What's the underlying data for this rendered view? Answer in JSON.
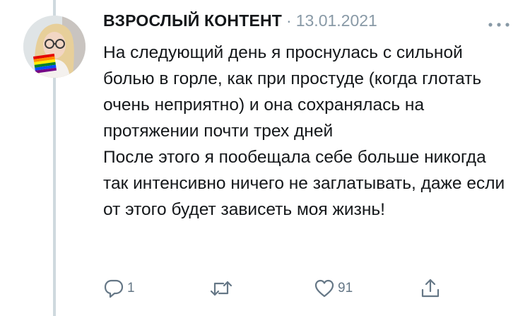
{
  "tweet": {
    "author_name": "ВЗРОСЛЫЙ КОНТЕНТ",
    "separator": "·",
    "date": "13.01.2021",
    "text": "На следующий день я проснулась с сильной болью в горле, как при простуде (когда глотать очень неприятно) и она сохранялась на протяжении почти трех дней\nПосле этого я пообещала себе больше никогда так интенсивно ничего не заглатывать, даже если от этого будет зависеть моя жизнь!",
    "reply_count": "1",
    "retweet_count": "",
    "like_count": "91"
  },
  "icons": {
    "more": "more-horizontal-icon",
    "reply": "reply-bubble-icon",
    "retweet": "retweet-icon",
    "like": "heart-outline-icon",
    "share": "share-upload-icon"
  },
  "colors": {
    "text": "#14171a",
    "secondary": "#8899a6",
    "action_gray": "#657786",
    "thread_line": "#cfd9de"
  }
}
